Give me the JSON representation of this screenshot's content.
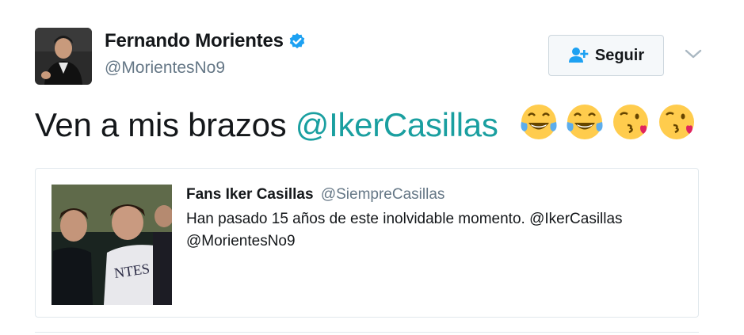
{
  "author": {
    "name": "Fernando Morientes",
    "handle": "@MorientesNo9",
    "verified": true
  },
  "follow_button": {
    "label": "Seguir",
    "icon": "add-user-icon"
  },
  "menu_icon": "chevron-down-icon",
  "tweet": {
    "text": "Ven a mis brazos ",
    "mention": "@IkerCasillas",
    "emojis": [
      "face-with-tears-of-joy",
      "face-with-tears-of-joy",
      "face-blowing-kiss",
      "face-blowing-kiss"
    ]
  },
  "quoted_tweet": {
    "author_name": "Fans Iker Casillas",
    "author_handle": "@SiempreCasillas",
    "text_line1": "Han pasado 15 años de este inolvidable momento. @IkerCasillas",
    "text_line2": "@MorientesNo9"
  },
  "colors": {
    "mention": "#1a9fa0",
    "verified": "#1da1f2",
    "secondary_text": "#657786",
    "border": "#e1e8ed"
  }
}
